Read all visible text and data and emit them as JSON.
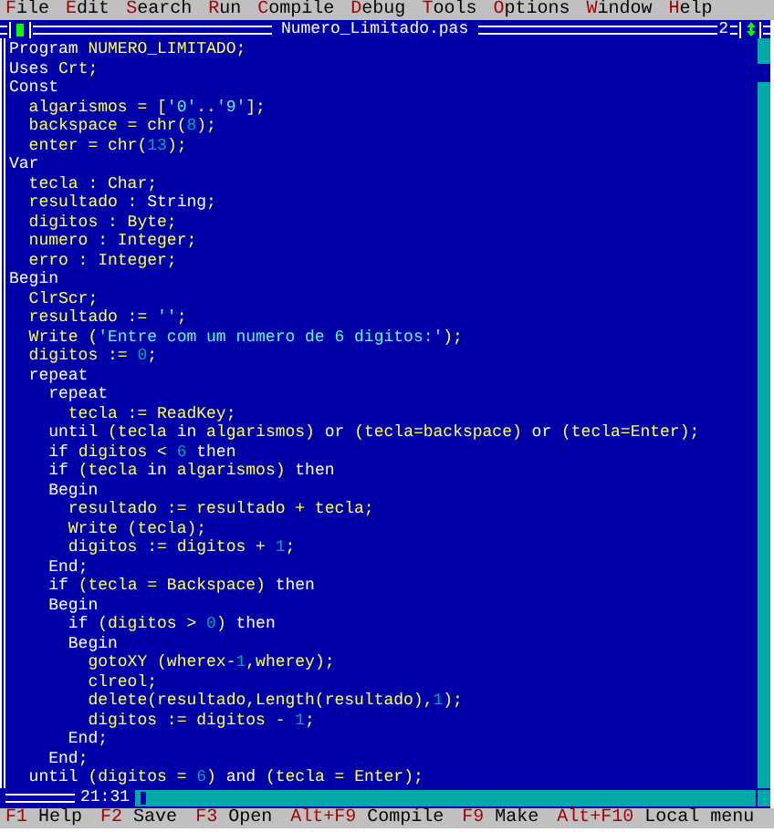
{
  "menu": [
    {
      "hotkey": "F",
      "rest": "ile"
    },
    {
      "hotkey": "E",
      "rest": "dit"
    },
    {
      "hotkey": "S",
      "rest": "earch"
    },
    {
      "hotkey": "R",
      "rest": "un"
    },
    {
      "hotkey": "C",
      "rest": "ompile"
    },
    {
      "hotkey": "D",
      "rest": "ebug"
    },
    {
      "hotkey": "T",
      "rest": "ools"
    },
    {
      "hotkey": "O",
      "rest": "ptions"
    },
    {
      "hotkey": "W",
      "rest": "indow"
    },
    {
      "hotkey": "H",
      "rest": "elp"
    }
  ],
  "window": {
    "title": "Numero_Limitado.pas",
    "number": "2",
    "cursor_position": "21:31"
  },
  "code": [
    [
      {
        "kind": "kw",
        "text": "Program "
      },
      {
        "kind": "id",
        "text": "NUMERO_LIMITADO;"
      }
    ],
    [
      {
        "kind": "kw",
        "text": "Uses "
      },
      {
        "kind": "id",
        "text": "Crt;"
      }
    ],
    [
      {
        "kind": "kw",
        "text": "Const"
      }
    ],
    [
      {
        "kind": "id",
        "text": "  algarismos = ["
      },
      {
        "kind": "str",
        "text": "'0'"
      },
      {
        "kind": "id",
        "text": ".."
      },
      {
        "kind": "str",
        "text": "'9'"
      },
      {
        "kind": "id",
        "text": "];"
      }
    ],
    [
      {
        "kind": "id",
        "text": "  backspace = chr("
      },
      {
        "kind": "num",
        "text": "8"
      },
      {
        "kind": "id",
        "text": ");"
      }
    ],
    [
      {
        "kind": "id",
        "text": "  enter = chr("
      },
      {
        "kind": "num",
        "text": "13"
      },
      {
        "kind": "id",
        "text": ");"
      }
    ],
    [
      {
        "kind": "kw",
        "text": "Var"
      }
    ],
    [
      {
        "kind": "id",
        "text": "  tecla : Char;"
      }
    ],
    [
      {
        "kind": "id",
        "text": "  resultado : "
      },
      {
        "kind": "kw",
        "text": "String"
      },
      {
        "kind": "id",
        "text": ";"
      }
    ],
    [
      {
        "kind": "id",
        "text": "  digitos : Byte;"
      }
    ],
    [
      {
        "kind": "id",
        "text": "  numero : Integer;"
      }
    ],
    [
      {
        "kind": "id",
        "text": "  erro : Integer;"
      }
    ],
    [
      {
        "kind": "kw",
        "text": "Begin"
      }
    ],
    [
      {
        "kind": "id",
        "text": "  ClrScr;"
      }
    ],
    [
      {
        "kind": "id",
        "text": "  resultado := "
      },
      {
        "kind": "str",
        "text": "''"
      },
      {
        "kind": "id",
        "text": ";"
      }
    ],
    [
      {
        "kind": "id",
        "text": "  Write ("
      },
      {
        "kind": "str",
        "text": "'Entre com um numero de 6 digitos:'"
      },
      {
        "kind": "id",
        "text": ");"
      }
    ],
    [
      {
        "kind": "id",
        "text": "  digitos := "
      },
      {
        "kind": "num",
        "text": "0"
      },
      {
        "kind": "id",
        "text": ";"
      }
    ],
    [
      {
        "kind": "kw",
        "text": "  repeat"
      }
    ],
    [
      {
        "kind": "kw",
        "text": "    repeat"
      }
    ],
    [
      {
        "kind": "id",
        "text": "      tecla := ReadKey;"
      }
    ],
    [
      {
        "kind": "kw",
        "text": "    until "
      },
      {
        "kind": "id",
        "text": "(tecla "
      },
      {
        "kind": "kw",
        "text": "in"
      },
      {
        "kind": "id",
        "text": " algarismos) "
      },
      {
        "kind": "kw",
        "text": "or"
      },
      {
        "kind": "id",
        "text": " (tecla=backspace) "
      },
      {
        "kind": "kw",
        "text": "or"
      },
      {
        "kind": "id",
        "text": " (tecla=Enter);"
      }
    ],
    [
      {
        "kind": "kw",
        "text": "    if "
      },
      {
        "kind": "id",
        "text": "digitos < "
      },
      {
        "kind": "num",
        "text": "6"
      },
      {
        "kind": "kw",
        "text": " then"
      }
    ],
    [
      {
        "kind": "kw",
        "text": "    if "
      },
      {
        "kind": "id",
        "text": "(tecla "
      },
      {
        "kind": "kw",
        "text": "in"
      },
      {
        "kind": "id",
        "text": " algarismos) "
      },
      {
        "kind": "kw",
        "text": "then"
      }
    ],
    [
      {
        "kind": "kw",
        "text": "    Begin"
      }
    ],
    [
      {
        "kind": "id",
        "text": "      resultado := resultado + tecla;"
      }
    ],
    [
      {
        "kind": "id",
        "text": "      Write (tecla);"
      }
    ],
    [
      {
        "kind": "id",
        "text": "      digitos := digitos + "
      },
      {
        "kind": "num",
        "text": "1"
      },
      {
        "kind": "id",
        "text": ";"
      }
    ],
    [
      {
        "kind": "kw",
        "text": "    End"
      },
      {
        "kind": "id",
        "text": ";"
      }
    ],
    [
      {
        "kind": "kw",
        "text": "    if "
      },
      {
        "kind": "id",
        "text": "(tecla = Backspace) "
      },
      {
        "kind": "kw",
        "text": "then"
      }
    ],
    [
      {
        "kind": "kw",
        "text": "    Begin"
      }
    ],
    [
      {
        "kind": "kw",
        "text": "      if "
      },
      {
        "kind": "id",
        "text": "(digitos > "
      },
      {
        "kind": "num",
        "text": "0"
      },
      {
        "kind": "id",
        "text": ") "
      },
      {
        "kind": "kw",
        "text": "then"
      }
    ],
    [
      {
        "kind": "kw",
        "text": "      Begin"
      }
    ],
    [
      {
        "kind": "id",
        "text": "        gotoXY (wherex-"
      },
      {
        "kind": "num",
        "text": "1"
      },
      {
        "kind": "id",
        "text": ",wherey);"
      }
    ],
    [
      {
        "kind": "id",
        "text": "        clreol;"
      }
    ],
    [
      {
        "kind": "id",
        "text": "        delete(resultado,Length(resultado),"
      },
      {
        "kind": "num",
        "text": "1"
      },
      {
        "kind": "id",
        "text": ");"
      }
    ],
    [
      {
        "kind": "id",
        "text": "        digitos := digitos - "
      },
      {
        "kind": "num",
        "text": "1"
      },
      {
        "kind": "id",
        "text": ";"
      }
    ],
    [
      {
        "kind": "kw",
        "text": "      End"
      },
      {
        "kind": "id",
        "text": ";"
      }
    ],
    [
      {
        "kind": "kw",
        "text": "    End"
      },
      {
        "kind": "id",
        "text": ";"
      }
    ],
    [
      {
        "kind": "kw",
        "text": "  until "
      },
      {
        "kind": "id",
        "text": "(digitos = "
      },
      {
        "kind": "num",
        "text": "6"
      },
      {
        "kind": "id",
        "text": ") "
      },
      {
        "kind": "kw",
        "text": "and"
      },
      {
        "kind": "id",
        "text": " (tecla = Enter);"
      }
    ]
  ],
  "status_bar": [
    {
      "key": "F1",
      "label": "Help"
    },
    {
      "key": "F2",
      "label": "Save"
    },
    {
      "key": "F3",
      "label": "Open"
    },
    {
      "key": "Alt+F9",
      "label": "Compile"
    },
    {
      "key": "F9",
      "label": "Make"
    },
    {
      "key": "Alt+F10",
      "label": "Local menu"
    }
  ]
}
